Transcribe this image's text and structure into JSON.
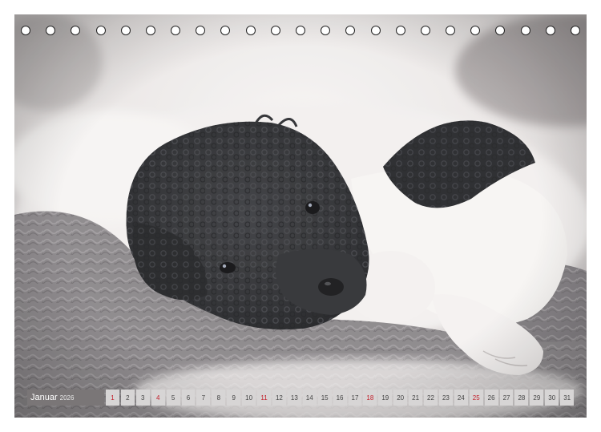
{
  "calendar": {
    "month": "Januar",
    "year": "2026",
    "days": [
      {
        "n": "1",
        "holiday": true
      },
      {
        "n": "2"
      },
      {
        "n": "3"
      },
      {
        "n": "4",
        "holiday": true
      },
      {
        "n": "5"
      },
      {
        "n": "6"
      },
      {
        "n": "7"
      },
      {
        "n": "8"
      },
      {
        "n": "9"
      },
      {
        "n": "10"
      },
      {
        "n": "11",
        "holiday": true
      },
      {
        "n": "12"
      },
      {
        "n": "13"
      },
      {
        "n": "14"
      },
      {
        "n": "15"
      },
      {
        "n": "16"
      },
      {
        "n": "17"
      },
      {
        "n": "18",
        "holiday": true
      },
      {
        "n": "19"
      },
      {
        "n": "20"
      },
      {
        "n": "21"
      },
      {
        "n": "22"
      },
      {
        "n": "23"
      },
      {
        "n": "24"
      },
      {
        "n": "25",
        "holiday": true
      },
      {
        "n": "26"
      },
      {
        "n": "27"
      },
      {
        "n": "28"
      },
      {
        "n": "29"
      },
      {
        "n": "30"
      },
      {
        "n": "31"
      }
    ],
    "ring_count": 23,
    "colors": {
      "month_bg": "#7a7677",
      "day_bg": "#d7d5d5",
      "holiday_text": "#c21f2b",
      "fur_white": "#f1eeed",
      "puppy_black": "#2a2b2e",
      "blanket_gray": "#8a8689"
    }
  }
}
